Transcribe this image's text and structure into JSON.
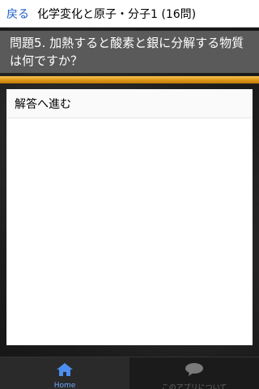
{
  "header": {
    "back_label": "戻る",
    "title": "化学変化と原子・分子1 (16問)"
  },
  "question": {
    "text": "問題5. 加熱すると酸素と銀に分解する物質は何ですか？"
  },
  "progress": {
    "fraction": 1.0,
    "color": "#e09a1a"
  },
  "answer": {
    "label": "解答へ進む"
  },
  "tabs": [
    {
      "label": "Home",
      "icon": "home-icon",
      "color": "#4d8ef0"
    },
    {
      "label": "このアプリについて",
      "icon": "speech-bubble-icon"
    }
  ]
}
